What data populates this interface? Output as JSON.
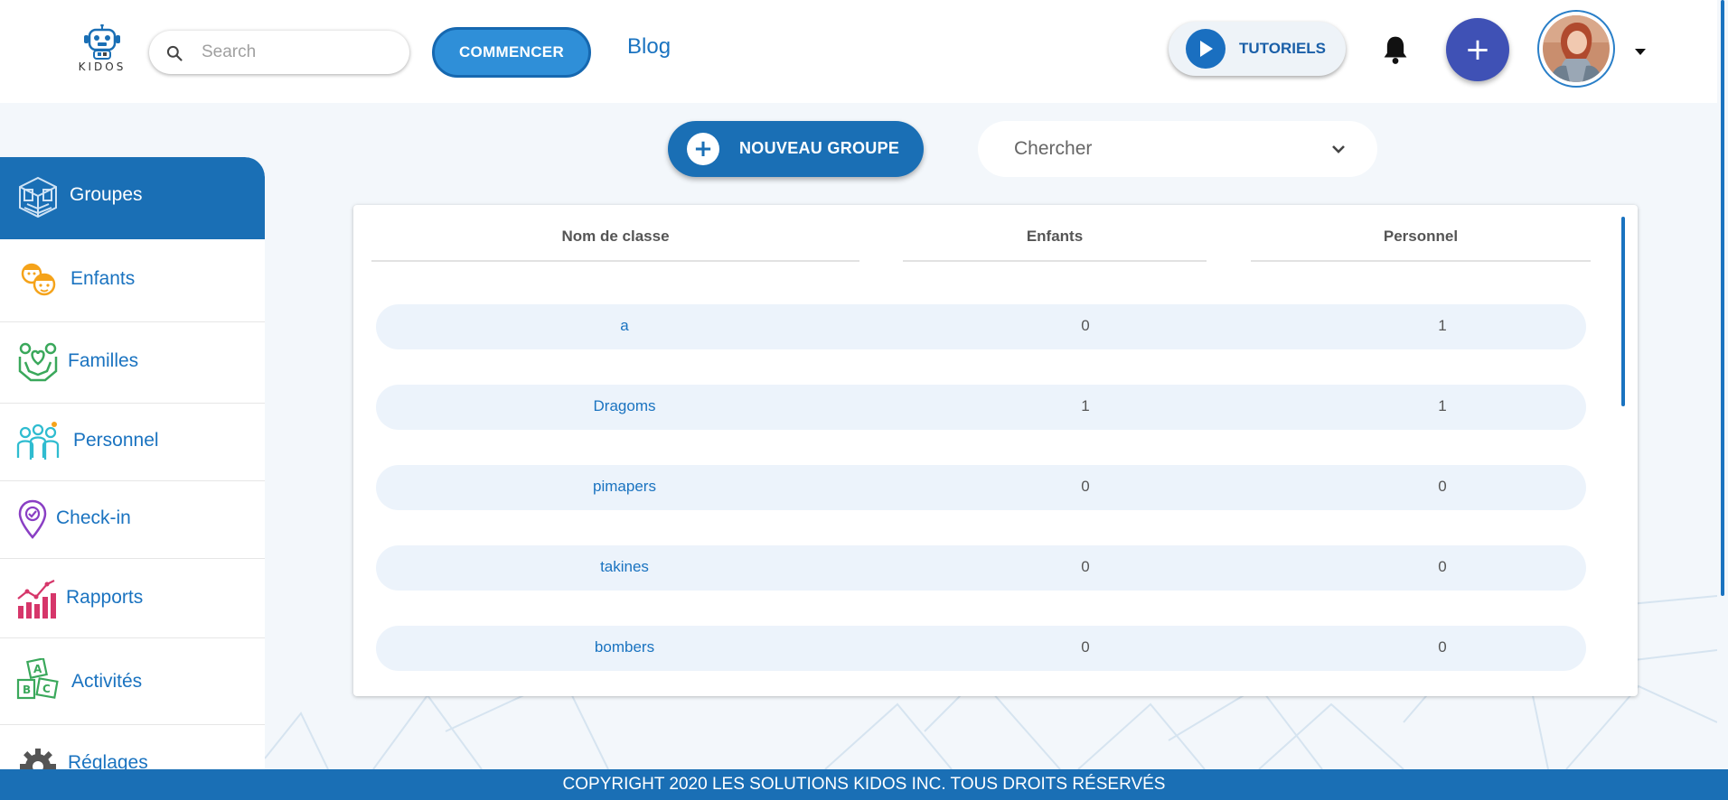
{
  "header": {
    "logo_text": "KIDOS",
    "search_placeholder": "Search",
    "search_value": "",
    "commencer_label": "COMMENCER",
    "blog_label": "Blog",
    "tutoriels_label": "TUTORIELS",
    "add_label": "+"
  },
  "sidebar": {
    "items": [
      {
        "label": "Groupes",
        "icon": "groups-cube-icon",
        "active": true
      },
      {
        "label": "Enfants",
        "icon": "children-faces-icon"
      },
      {
        "label": "Familles",
        "icon": "family-heart-icon"
      },
      {
        "label": "Personnel",
        "icon": "staff-people-icon"
      },
      {
        "label": "Check-in",
        "icon": "location-check-icon"
      },
      {
        "label": "Rapports",
        "icon": "reports-chart-icon"
      },
      {
        "label": "Activités",
        "icon": "abc-blocks-icon"
      },
      {
        "label": "Réglages",
        "icon": "gear-icon"
      }
    ]
  },
  "toolbar": {
    "new_group_label": "NOUVEAU GROUPE",
    "filter_value": "Chercher"
  },
  "table": {
    "columns": [
      "Nom de classe",
      "Enfants",
      "Personnel"
    ],
    "rows": [
      {
        "name": "a",
        "enfants": "0",
        "personnel": "1"
      },
      {
        "name": "Dragoms",
        "enfants": "1",
        "personnel": "1"
      },
      {
        "name": "pimapers",
        "enfants": "0",
        "personnel": "0"
      },
      {
        "name": "takines",
        "enfants": "0",
        "personnel": "0"
      },
      {
        "name": "bombers",
        "enfants": "0",
        "personnel": "0"
      }
    ]
  },
  "footer": {
    "copyright": "COPYRIGHT 2020 LES SOLUTIONS KIDOS INC. TOUS DROITS RÉSERVÉS"
  },
  "colors": {
    "primary": "#1a6fb5",
    "link": "#1a73c0",
    "add_button": "#3f51b5",
    "row_background": "#ecf3fb",
    "page_background": "#f3f7fb"
  }
}
